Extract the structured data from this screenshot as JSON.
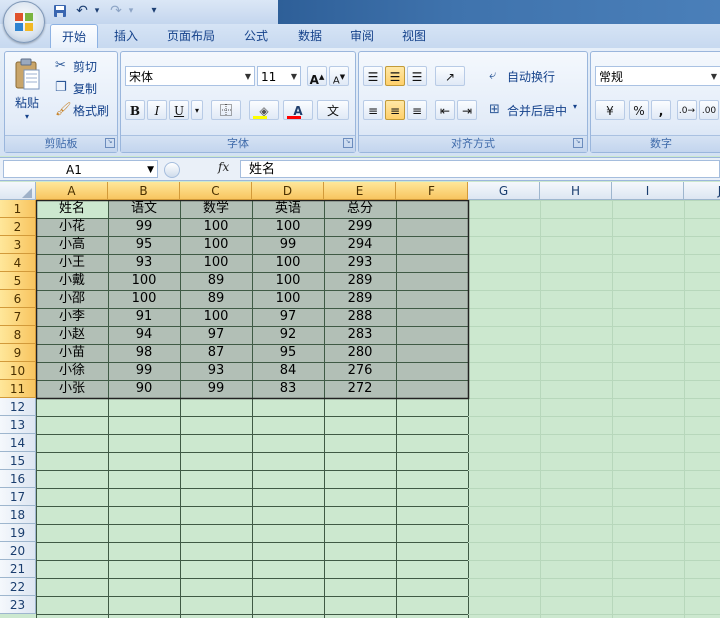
{
  "quick_access": {
    "undo": "↶",
    "redo": "↷",
    "customize": "▾"
  },
  "tabs": [
    "开始",
    "插入",
    "页面布局",
    "公式",
    "数据",
    "审阅",
    "视图"
  ],
  "clipboard": {
    "paste": "粘贴",
    "cut": "剪切",
    "copy": "复制",
    "format_painter": "格式刷",
    "group": "剪贴板"
  },
  "font": {
    "name": "宋体",
    "size": "11",
    "group": "字体",
    "grow": "A",
    "shrink": "A",
    "bold": "B",
    "italic": "I",
    "underline": "U",
    "color_letter": "A",
    "phonetic": "文"
  },
  "alignment": {
    "wrap": "自动换行",
    "merge": "合并后居中",
    "group": "对齐方式"
  },
  "number": {
    "format": "常规",
    "percent": "%",
    "comma": ",",
    "group": "数字"
  },
  "formula_bar": {
    "cell_ref": "A1",
    "fx": "fx",
    "content": "姓名"
  },
  "columns": [
    "A",
    "B",
    "C",
    "D",
    "E",
    "F",
    "G",
    "H",
    "I",
    "J"
  ],
  "row_numbers": [
    "1",
    "2",
    "3",
    "4",
    "5",
    "6",
    "7",
    "8",
    "9",
    "10",
    "11",
    "12",
    "13",
    "14",
    "15",
    "16",
    "17",
    "18",
    "19",
    "20",
    "21",
    "22",
    "23"
  ],
  "table": {
    "headers": [
      "姓名",
      "语文",
      "数学",
      "英语",
      "总分"
    ],
    "rows": [
      [
        "小花",
        "99",
        "100",
        "100",
        "299"
      ],
      [
        "小高",
        "95",
        "100",
        "99",
        "294"
      ],
      [
        "小王",
        "93",
        "100",
        "100",
        "293"
      ],
      [
        "小戴",
        "100",
        "89",
        "100",
        "289"
      ],
      [
        "小邵",
        "100",
        "89",
        "100",
        "289"
      ],
      [
        "小李",
        "91",
        "100",
        "97",
        "288"
      ],
      [
        "小赵",
        "94",
        "97",
        "92",
        "283"
      ],
      [
        "小苗",
        "98",
        "87",
        "95",
        "280"
      ],
      [
        "小徐",
        "99",
        "93",
        "84",
        "276"
      ],
      [
        "小张",
        "90",
        "99",
        "83",
        "272"
      ]
    ]
  },
  "colors": {
    "sheet_bg": "#cce8cf",
    "selection": "#b2bfb6",
    "header_selected": "#f8c560",
    "ribbon": "#d3e1f3"
  }
}
